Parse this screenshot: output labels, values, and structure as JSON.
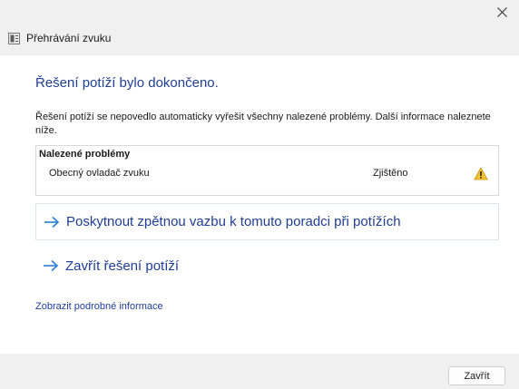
{
  "window": {
    "title": "Přehrávání zvuku"
  },
  "main": {
    "heading": "Řešení potíží bylo dokončeno.",
    "description": "Řešení potíží se nepovedlo automaticky vyřešit všechny nalezené problémy. Další informace naleznete níže.",
    "problems": {
      "header": "Nalezené problémy",
      "items": [
        {
          "name": "Obecný ovladač zvuku",
          "status": "Zjištěno",
          "icon": "warning-icon"
        }
      ]
    },
    "feedback_link": "Poskytnout zpětnou vazbu k tomuto poradci při potížích",
    "close_link": "Zavřít řešení potíží",
    "details_link": "Zobrazit podrobné informace"
  },
  "footer": {
    "close_button": "Zavřít"
  },
  "colors": {
    "accent_text": "#1f3e94",
    "arrow": "#2a7fd4",
    "warning": "#f3c331"
  }
}
